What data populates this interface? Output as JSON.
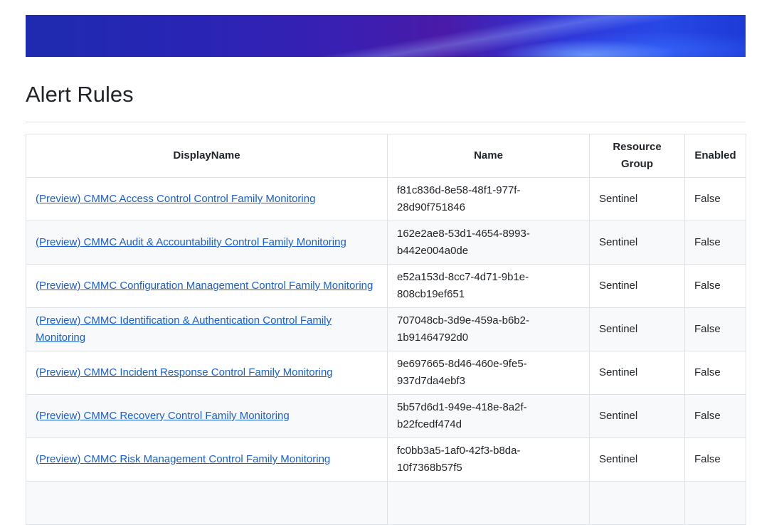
{
  "page": {
    "title": "Alert Rules"
  },
  "table": {
    "headers": {
      "display_name": "DisplayName",
      "name": "Name",
      "resource_group": "Resource Group",
      "enabled": "Enabled"
    },
    "rows": [
      {
        "display_name": "(Preview) CMMC Access Control Control Family Monitoring",
        "name_line1": "f81c836d-8e58-48f1-977f-",
        "name_line2": "28d90f751846",
        "resource_group": "Sentinel",
        "enabled": "False"
      },
      {
        "display_name": "(Preview) CMMC Audit & Accountability Control Family Monitoring",
        "name_line1": "162e2ae8-53d1-4654-8993-",
        "name_line2": "b442e004a0de",
        "resource_group": "Sentinel",
        "enabled": "False"
      },
      {
        "display_name": "(Preview) CMMC Configuration Management Control Family Monitoring",
        "name_line1": "e52a153d-8cc7-4d71-9b1e-",
        "name_line2": "808cb19ef651",
        "resource_group": "Sentinel",
        "enabled": "False"
      },
      {
        "display_name": "(Preview) CMMC Identification & Authentication Control Family Monitoring",
        "name_line1": "707048cb-3d9e-459a-b6b2-",
        "name_line2": "1b91464792d0",
        "resource_group": "Sentinel",
        "enabled": "False"
      },
      {
        "display_name": "(Preview) CMMC Incident Response Control Family Monitoring",
        "name_line1": "9e697665-8d46-460e-9fe5-",
        "name_line2": "937d7da4ebf3",
        "resource_group": "Sentinel",
        "enabled": "False"
      },
      {
        "display_name": "(Preview) CMMC Recovery Control Family Monitoring",
        "name_line1": "5b57d6d1-949e-418e-8a2f-",
        "name_line2": "b22fcedf474d",
        "resource_group": "Sentinel",
        "enabled": "False"
      },
      {
        "display_name": "(Preview) CMMC Risk Management Control Family Monitoring",
        "name_line1": "fc0bb3a5-1af0-42f3-b8da-",
        "name_line2": "10f7368b57f5",
        "resource_group": "Sentinel",
        "enabled": "False"
      }
    ]
  }
}
